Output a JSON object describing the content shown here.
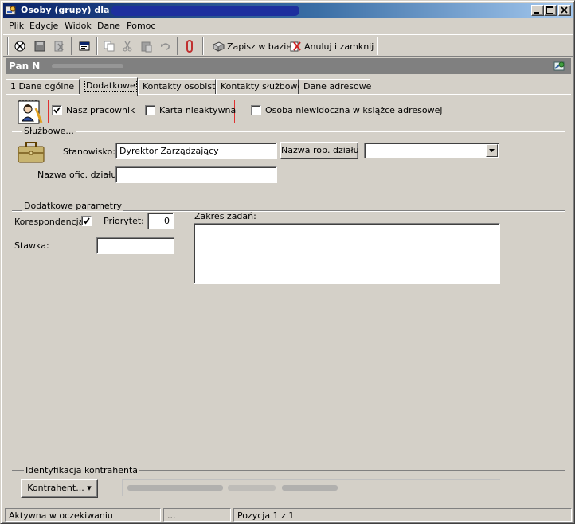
{
  "window": {
    "title": "Osoby (grupy) dla :",
    "caption_buttons": [
      "minimize-icon",
      "maximize-icon",
      "close-icon"
    ]
  },
  "menu": [
    "Plik",
    "Edycje",
    "Widok",
    "Dane",
    "Pomoc"
  ],
  "toolbar": {
    "icons": [
      "delete-record-icon",
      "save-disk-icon",
      "cut-record-icon",
      "properties-icon",
      "copy-icon",
      "scissors-icon",
      "paste-icon",
      "undo-icon",
      "attachment-icon"
    ],
    "save_label": "Zapisz w bazie",
    "cancel_label": "Anuluj i zamknij"
  },
  "header": {
    "name_prefix": "Pan N"
  },
  "tabs": [
    "1 Dane ogólne",
    "Dodatkowe",
    "Kontakty osobiste",
    "Kontakty służbowe",
    "Dane adresowe"
  ],
  "options": {
    "nasz_pracownik": {
      "label": "Nasz pracownik",
      "checked": true
    },
    "karta_nieaktywna": {
      "label": "Karta nieaktywna",
      "checked": false
    },
    "osoba_niewidoczna": {
      "label": "Osoba niewidoczna w książce adresowej",
      "checked": false
    }
  },
  "sluzbowe": {
    "title": "Służbowe...",
    "stanowisko_label": "Stanowisko:",
    "stanowisko_value": "Dyrektor Zarządzający",
    "nazwa_rob_dzialu_button": "Nazwa rob. działu",
    "nazwa_rob_dzialu_value": "",
    "nazwa_ofic_label": "Nazwa ofic. działu:",
    "nazwa_ofic_value": ""
  },
  "dodatkowe": {
    "title": "Dodatkowe parametry",
    "korespondencja_label": "Korespondencja",
    "korespondencja_checked": true,
    "priorytet_label": "Priorytet:",
    "priorytet_value": "0",
    "stawka_label": "Stawka:",
    "stawka_value": "",
    "zakres_label": "Zakres zadań:",
    "zakres_value": ""
  },
  "identyfikacja": {
    "title": "Identyfikacja kontrahenta",
    "button_label": "Kontrahent... ▾"
  },
  "status": {
    "left": "Aktywna w oczekiwaniu",
    "middle": "...",
    "position": "Pozycja 1 z 1"
  }
}
